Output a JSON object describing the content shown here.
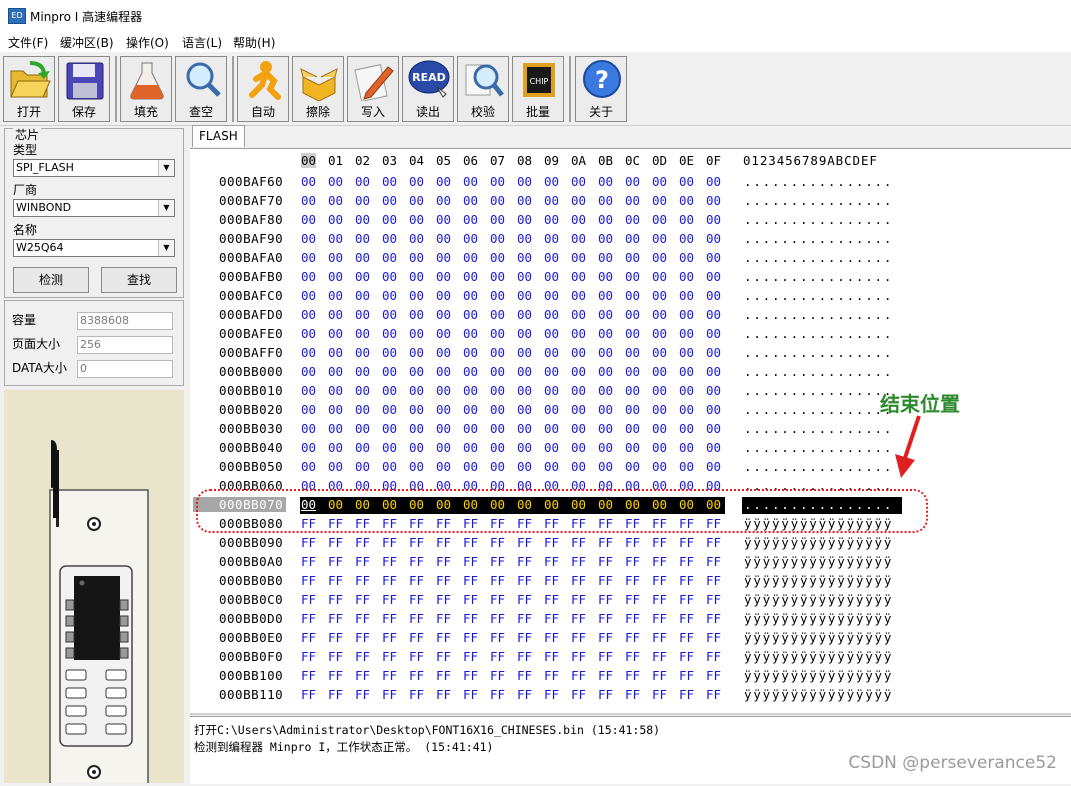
{
  "window": {
    "title": "Minpro I 高速编程器",
    "icon": "app-icon"
  },
  "menu": [
    "文件(F)",
    "缓冲区(B)",
    "操作(O)",
    "语言(L)",
    "帮助(H)"
  ],
  "toolbar": [
    {
      "label": "打开",
      "icon": "folder-open-icon"
    },
    {
      "label": "保存",
      "icon": "floppy-save-icon"
    },
    {
      "label": "填充",
      "icon": "flask-fill-icon"
    },
    {
      "label": "查空",
      "icon": "magnifier-blank-check-icon"
    },
    {
      "label": "自动",
      "icon": "running-man-icon"
    },
    {
      "label": "擦除",
      "icon": "open-box-erase-icon"
    },
    {
      "label": "写入",
      "icon": "pencil-write-icon"
    },
    {
      "label": "读出",
      "icon": "read-badge-icon",
      "badge": "READ"
    },
    {
      "label": "校验",
      "icon": "magnifier-verify-icon"
    },
    {
      "label": "批量",
      "icon": "chip-batch-icon",
      "badge": "CHIP"
    },
    {
      "label": "关于",
      "icon": "help-question-icon",
      "badge": "?"
    }
  ],
  "chip": {
    "group_title": "芯片",
    "type_label": "类型",
    "type_value": "SPI_FLASH",
    "vendor_label": "厂商",
    "vendor_value": "WINBOND",
    "name_label": "名称",
    "name_value": "W25Q64",
    "detect_label": "检测",
    "search_label": "查找"
  },
  "info": {
    "capacity_label": "容量",
    "capacity_value": "8388608",
    "page_label": "页面大小",
    "page_value": "256",
    "data_label": "DATA大小",
    "data_value": "0"
  },
  "tab": "FLASH",
  "hex": {
    "header_bytes": [
      "00",
      "01",
      "02",
      "03",
      "04",
      "05",
      "06",
      "07",
      "08",
      "09",
      "0A",
      "0B",
      "0C",
      "0D",
      "0E",
      "0F"
    ],
    "header_ascii": "0123456789ABCDEF",
    "rows": [
      {
        "addr": "000BAF60",
        "fill": "00",
        "ascii": "................"
      },
      {
        "addr": "000BAF70",
        "fill": "00",
        "ascii": "................"
      },
      {
        "addr": "000BAF80",
        "fill": "00",
        "ascii": "................"
      },
      {
        "addr": "000BAF90",
        "fill": "00",
        "ascii": "................"
      },
      {
        "addr": "000BAFA0",
        "fill": "00",
        "ascii": "................"
      },
      {
        "addr": "000BAFB0",
        "fill": "00",
        "ascii": "................"
      },
      {
        "addr": "000BAFC0",
        "fill": "00",
        "ascii": "................"
      },
      {
        "addr": "000BAFD0",
        "fill": "00",
        "ascii": "................"
      },
      {
        "addr": "000BAFE0",
        "fill": "00",
        "ascii": "................"
      },
      {
        "addr": "000BAFF0",
        "fill": "00",
        "ascii": "................"
      },
      {
        "addr": "000BB000",
        "fill": "00",
        "ascii": "................"
      },
      {
        "addr": "000BB010",
        "fill": "00",
        "ascii": "................"
      },
      {
        "addr": "000BB020",
        "fill": "00",
        "ascii": "................"
      },
      {
        "addr": "000BB030",
        "fill": "00",
        "ascii": "................"
      },
      {
        "addr": "000BB040",
        "fill": "00",
        "ascii": "................"
      },
      {
        "addr": "000BB050",
        "fill": "00",
        "ascii": "................"
      },
      {
        "addr": "000BB060",
        "fill": "00",
        "ascii": "................"
      },
      {
        "addr": "000BB070",
        "fill": "00",
        "ascii": "................",
        "selected": true
      },
      {
        "addr": "000BB080",
        "fill": "FF",
        "ascii": "ÿÿÿÿÿÿÿÿÿÿÿÿÿÿÿÿ"
      },
      {
        "addr": "000BB090",
        "fill": "FF",
        "ascii": "ÿÿÿÿÿÿÿÿÿÿÿÿÿÿÿÿ"
      },
      {
        "addr": "000BB0A0",
        "fill": "FF",
        "ascii": "ÿÿÿÿÿÿÿÿÿÿÿÿÿÿÿÿ"
      },
      {
        "addr": "000BB0B0",
        "fill": "FF",
        "ascii": "ÿÿÿÿÿÿÿÿÿÿÿÿÿÿÿÿ"
      },
      {
        "addr": "000BB0C0",
        "fill": "FF",
        "ascii": "ÿÿÿÿÿÿÿÿÿÿÿÿÿÿÿÿ"
      },
      {
        "addr": "000BB0D0",
        "fill": "FF",
        "ascii": "ÿÿÿÿÿÿÿÿÿÿÿÿÿÿÿÿ"
      },
      {
        "addr": "000BB0E0",
        "fill": "FF",
        "ascii": "ÿÿÿÿÿÿÿÿÿÿÿÿÿÿÿÿ"
      },
      {
        "addr": "000BB0F0",
        "fill": "FF",
        "ascii": "ÿÿÿÿÿÿÿÿÿÿÿÿÿÿÿÿ"
      },
      {
        "addr": "000BB100",
        "fill": "FF",
        "ascii": "ÿÿÿÿÿÿÿÿÿÿÿÿÿÿÿÿ"
      },
      {
        "addr": "000BB110",
        "fill": "FF",
        "ascii": "ÿÿÿÿÿÿÿÿÿÿÿÿÿÿÿÿ"
      }
    ]
  },
  "log": [
    "打开C:\\Users\\Administrator\\Desktop\\FONT16X16_CHINESES.bin (15:41:58)",
    "检测到编程器 Minpro I，工作状态正常。 (15:41:41)"
  ],
  "annotation": "结束位置",
  "watermark": "CSDN @perseverance52",
  "colors": {
    "hex_byte": "#1a1ad6",
    "selected_byte": "#ffd200",
    "annotation": "#2d8a2d",
    "annotation_box": "#e02020"
  }
}
